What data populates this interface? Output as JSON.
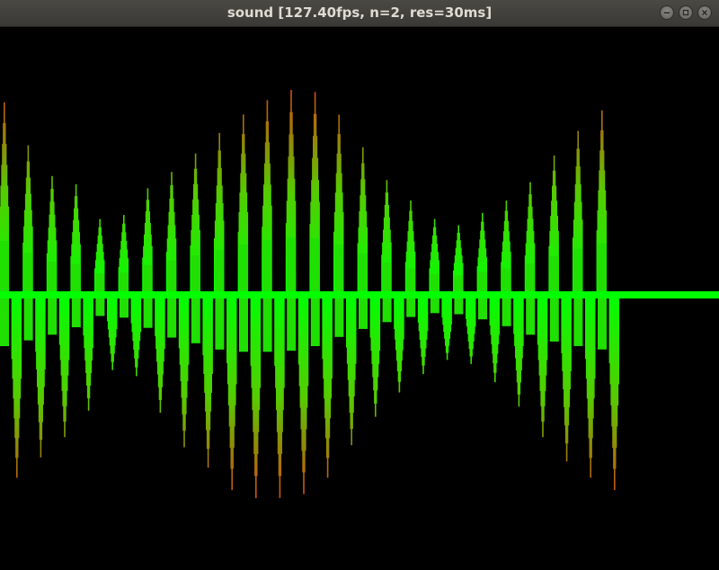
{
  "window": {
    "title": "sound [127.40fps, n=2, res=30ms]",
    "buttons": [
      "minimize",
      "maximize",
      "close"
    ]
  },
  "waveform": {
    "background": "#000000",
    "center_color": "#00ff00",
    "peak_color": "#cc5511",
    "peaks_top": [
      0.94,
      0.73,
      0.58,
      0.54,
      0.37,
      0.39,
      0.52,
      0.6,
      0.69,
      0.79,
      0.88,
      0.95,
      1.0,
      0.99,
      0.88,
      0.72,
      0.56,
      0.46,
      0.37,
      0.34,
      0.4,
      0.46,
      0.55,
      0.68,
      0.8,
      0.9
    ],
    "peaks_bottom": [
      0.9,
      0.8,
      0.7,
      0.57,
      0.37,
      0.4,
      0.58,
      0.75,
      0.85,
      0.96,
      1.0,
      1.0,
      0.98,
      0.9,
      0.74,
      0.6,
      0.48,
      0.39,
      0.32,
      0.34,
      0.43,
      0.55,
      0.7,
      0.82,
      0.9,
      0.96
    ]
  }
}
